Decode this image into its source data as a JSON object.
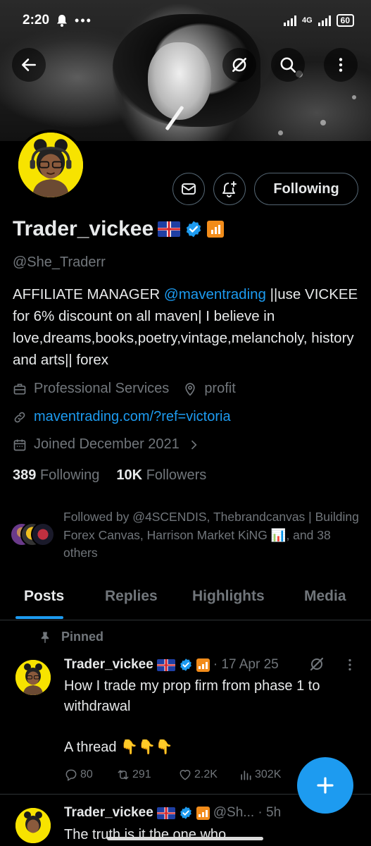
{
  "status_bar": {
    "time": "2:20",
    "network": "4G",
    "battery": "60"
  },
  "profile": {
    "name": "Trader_vickee",
    "handle": "@She_Traderr",
    "following_button_label": "Following",
    "bio_prefix": "AFFILIATE MANAGER ",
    "bio_mention": "@maventrading",
    "bio_suffix": " ||use VICKEE for 6% discount on all maven| I believe in love,dreams,books,poetry,vintage,melancholy, history and arts|| forex",
    "category": "Professional Services",
    "location": "profit",
    "website": "maventrading.com/?ref=victoria",
    "joined": "Joined December 2021",
    "following_count": "389",
    "following_label": "Following",
    "followers_count": "10K",
    "followers_label": "Followers",
    "followed_by": "Followed by @4SCENDIS, Thebrandcanvas | Building Forex Canvas, Harrison Market KiNG 📊, and 38 others"
  },
  "tabs": [
    "Posts",
    "Replies",
    "Highlights",
    "Media"
  ],
  "pinned_label": "Pinned",
  "tweets": [
    {
      "name": "Trader_vickee",
      "meta": "· 17 Apr 25",
      "body_line1": "How I trade my prop firm from phase 1 to withdrawal",
      "body_line2": "A thread 👇👇👇",
      "replies": "80",
      "reposts": "291",
      "likes": "2.2K",
      "views": "302K"
    },
    {
      "name": "Trader_vickee",
      "meta": "@Sh... · 5h",
      "body_line1": "The truth is it the one who..."
    }
  ],
  "colors": {
    "accent": "#1d9bf0",
    "background": "#000000",
    "text_primary": "#e7e9ea",
    "text_secondary": "#71767b",
    "avatar_bg": "#f7e300",
    "org_badge": "#f28c1a"
  },
  "icons": [
    "back-arrow-icon",
    "grok-icon",
    "search-icon",
    "more-vertical-icon",
    "message-icon",
    "notification-bell-icon",
    "briefcase-icon",
    "location-icon",
    "link-icon",
    "calendar-icon",
    "chevron-right-icon",
    "pin-icon",
    "reply-icon",
    "repost-icon",
    "like-icon",
    "views-icon",
    "compose-plus-icon"
  ]
}
